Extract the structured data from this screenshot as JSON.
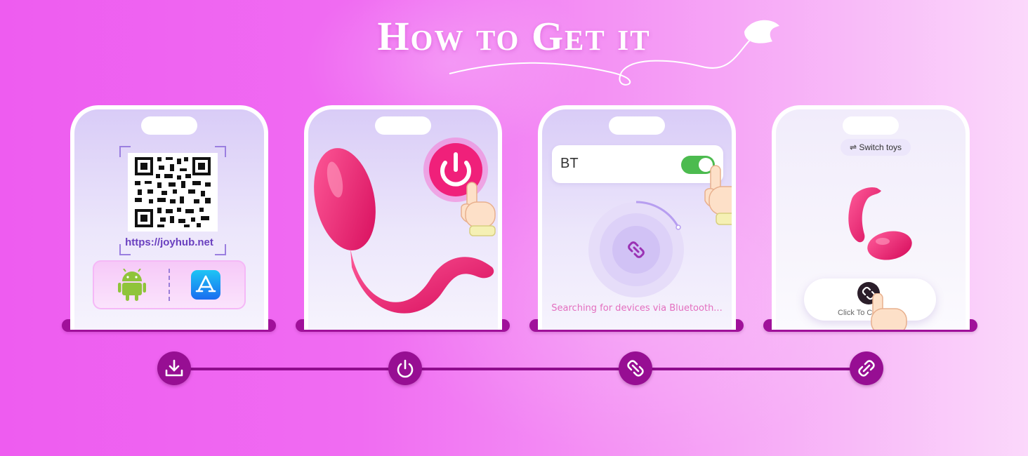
{
  "title": "How to Get it",
  "colors": {
    "background_left": "#ee5cf0",
    "background_right": "#fbd8fb",
    "accent_purple": "#970e93",
    "toy_pink": "#f2196e",
    "toggle_green": "#4cbb4f"
  },
  "steps": [
    {
      "icon": "download-icon",
      "url_text": "https://joyhub.net",
      "stores": [
        "android-icon",
        "app-store-icon"
      ]
    },
    {
      "icon": "power-icon"
    },
    {
      "icon": "link-icon",
      "bt_label": "BT",
      "toggle_on": true,
      "search_text": "Searching for devices via Bluetooth..."
    },
    {
      "icon": "link-icon",
      "switch_label": "⇌ Switch toys",
      "connect_label": "Click To Co"
    }
  ]
}
